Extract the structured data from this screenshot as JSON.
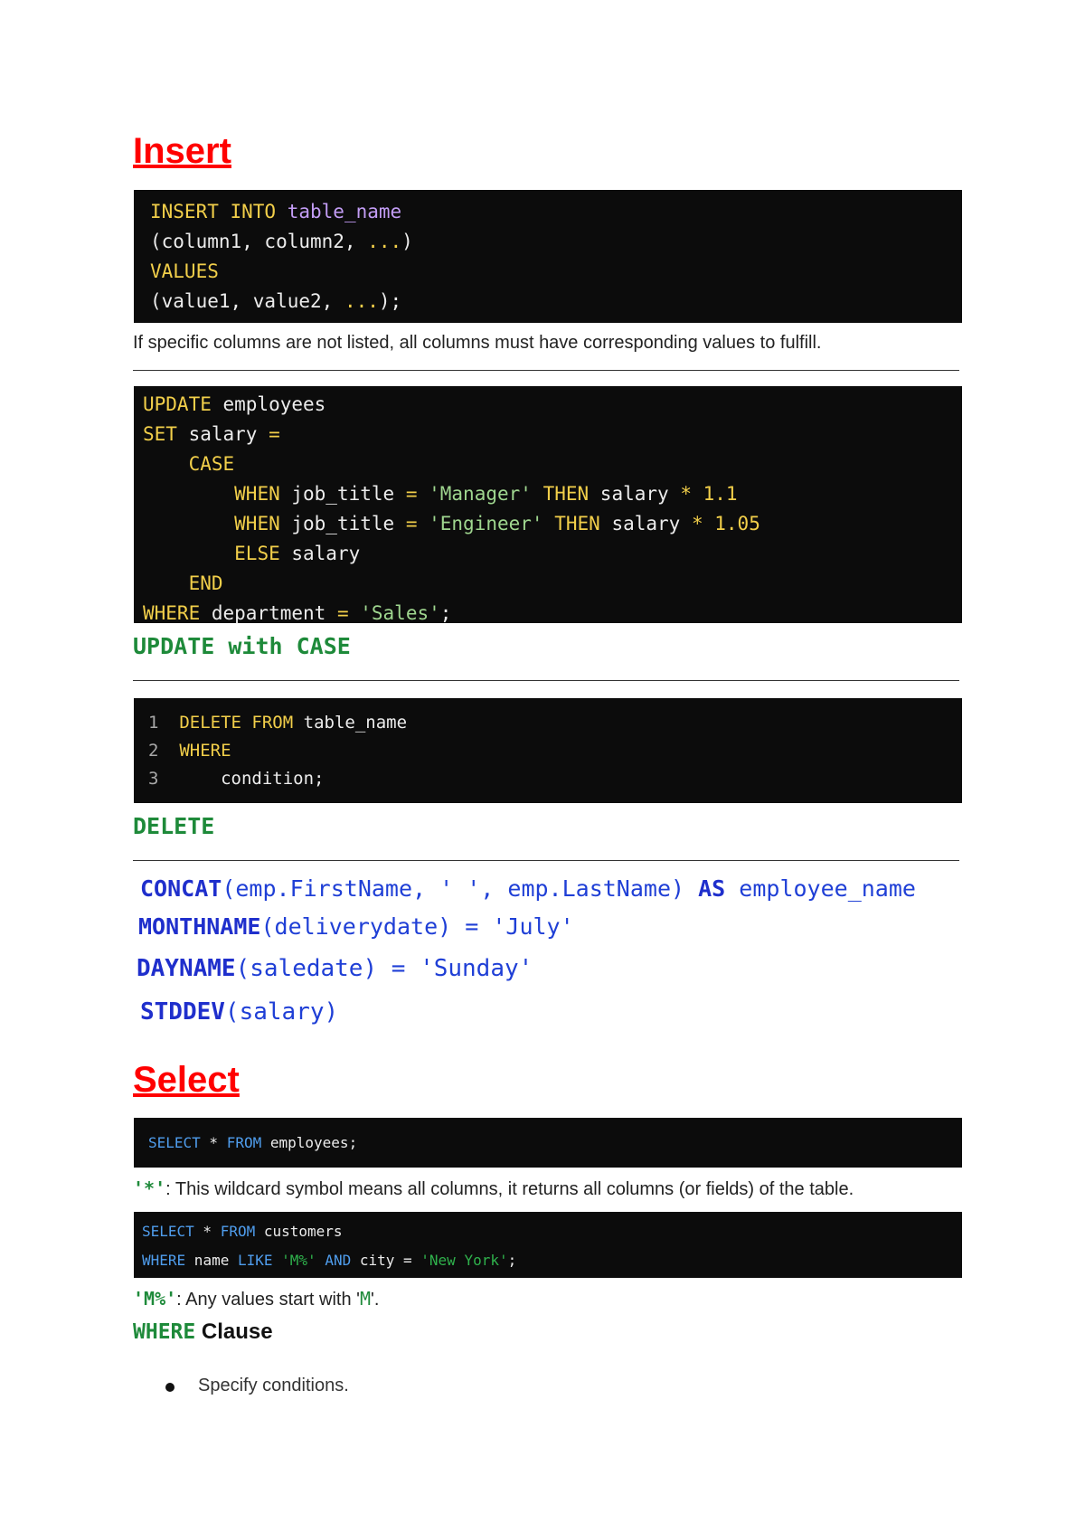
{
  "insert": {
    "heading": "Insert",
    "code": {
      "line1_kw": "INSERT INTO",
      "line1_obj": "table_name",
      "line2": "(column1, column2, ",
      "line2_dots": "...",
      "line2_end": ")",
      "line3_kw": "VALUES",
      "line4": "(value1, value2, ",
      "line4_dots": "...",
      "line4_end": ");"
    },
    "note": "If specific columns are not listed, all columns must have corresponding values to fulfill."
  },
  "update": {
    "code": {
      "l1_kw": "UPDATE",
      "l1_txt": " employees",
      "l2_kw": "SET",
      "l2_txt": " salary ",
      "l2_op": "=",
      "l3_kw": "CASE",
      "l4_kw": "WHEN",
      "l4_txt": " job_title ",
      "l4_op": "=",
      "l4_str": "'Manager'",
      "l4_kw2": "THEN",
      "l4_txt2": " salary ",
      "l4_op2": "*",
      "l4_num": "1.1",
      "l5_kw": "WHEN",
      "l5_txt": " job_title ",
      "l5_op": "=",
      "l5_str": "'Engineer'",
      "l5_kw2": "THEN",
      "l5_txt2": " salary ",
      "l5_op2": "*",
      "l5_num": "1.05",
      "l6_kw": "ELSE",
      "l6_txt": " salary",
      "l7_kw": "END",
      "l8_kw": "WHERE",
      "l8_txt": " department ",
      "l8_op": "=",
      "l8_str": "'Sales'",
      "l8_end": ";"
    },
    "label": "UPDATE with CASE"
  },
  "delete": {
    "code": {
      "n1": "1",
      "l1_kw": "DELETE FROM",
      "l1_txt": " table_name",
      "n2": "2",
      "l2_kw": "WHERE",
      "n3": "3",
      "l3_txt": "condition;"
    },
    "label": "DELETE"
  },
  "functions": {
    "f1_name": "CONCAT",
    "f1_args": "(emp.FirstName, ' ', emp.LastName)",
    "f1_as": "AS",
    "f1_alias": "employee_name",
    "f2_name": "MONTHNAME",
    "f2_args": "(deliverydate) = 'July'",
    "f3_name": "DAYNAME",
    "f3_args": "(saledate) = 'Sunday'",
    "f4_name": "STDDEV",
    "f4_args": "(salary)"
  },
  "select": {
    "heading": "Select",
    "code1": {
      "kw1": "SELECT",
      "op": " * ",
      "kw2": "FROM",
      "txt": " employees;"
    },
    "wildcard_symbol": "'*'",
    "wildcard_note": ": This wildcard symbol means all columns, it returns all columns (or fields) of the table.",
    "code2": {
      "l1_kw1": "SELECT",
      "l1_op": " * ",
      "l1_kw2": "FROM",
      "l1_txt": " customers",
      "l2_kw1": "WHERE",
      "l2_txt1": " name ",
      "l2_kw2": "LIKE",
      "l2_str1": "'M%'",
      "l2_kw3": "AND",
      "l2_txt2": " city = ",
      "l2_str2": "'New York'",
      "l2_end": ";"
    },
    "m_symbol": "'M%'",
    "m_note_a": ": Any values start with '",
    "m_note_m": "M",
    "m_note_b": "'.",
    "where_kw": "WHERE",
    "where_label": " Clause",
    "bullets": [
      "Specify conditions."
    ]
  },
  "colors": {
    "heading_red": "#ff0000",
    "code_bg": "#0c0c0c",
    "keyword_yellow": "#f2cf4a",
    "label_green": "#1e8a3a",
    "function_blue": "#1f2fcc"
  }
}
